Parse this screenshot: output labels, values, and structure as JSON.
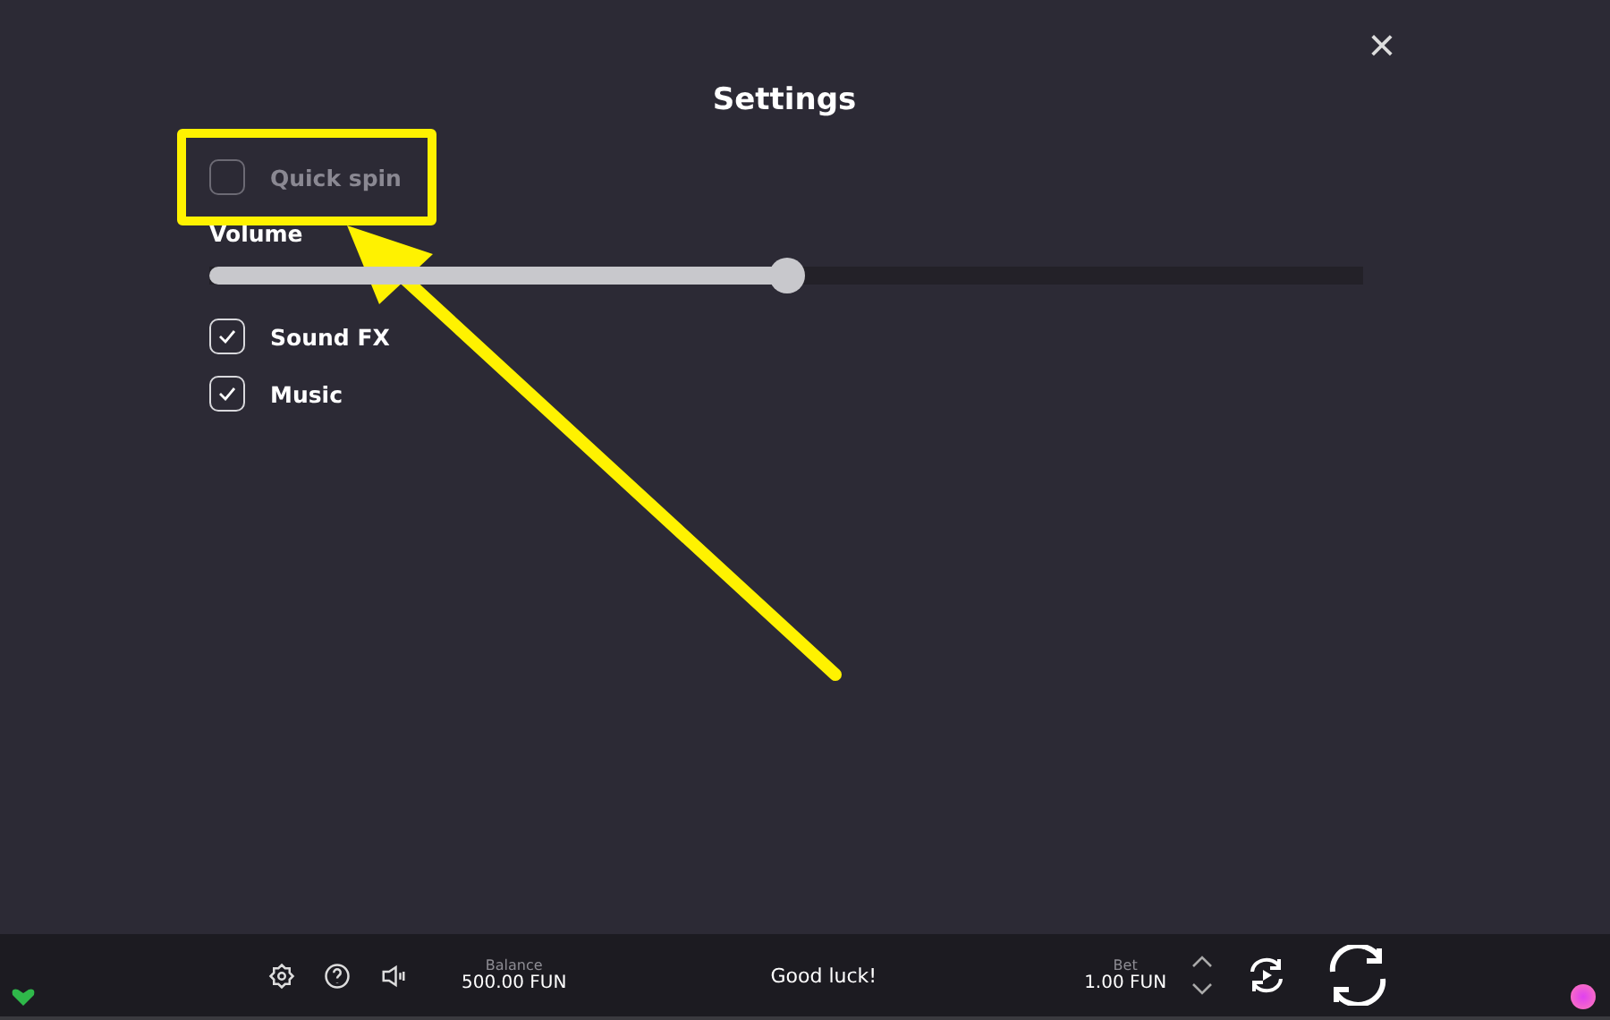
{
  "dialog": {
    "title": "Settings",
    "close": "×"
  },
  "options": [
    {
      "kind": "checkbox",
      "label": "Quick spin",
      "checked": false,
      "disabled": true,
      "highlighted": true
    },
    {
      "kind": "slider",
      "label": "Volume",
      "level": 0.5
    },
    {
      "kind": "checkbox",
      "label": "Sound FX",
      "checked": true,
      "disabled": false,
      "highlighted": false
    },
    {
      "kind": "checkbox",
      "label": "Music",
      "checked": true,
      "disabled": false,
      "highlighted": false
    }
  ],
  "bottom_bar": {
    "balance_label": "Balance",
    "balance": "500.00 FUN",
    "message": "Good luck!",
    "bet_label": "Bet",
    "bet": "1.00 FUN"
  }
}
